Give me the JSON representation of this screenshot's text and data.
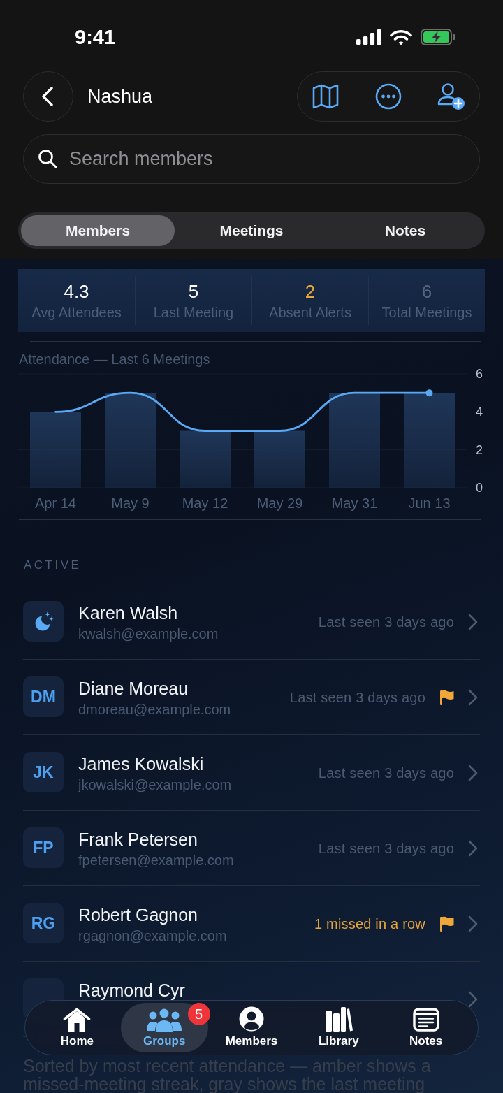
{
  "status_bar": {
    "time": "9:41"
  },
  "header": {
    "title": "Nashua"
  },
  "search": {
    "placeholder": "Search members"
  },
  "tabs": [
    {
      "label": "Members",
      "selected": true
    },
    {
      "label": "Meetings",
      "selected": false
    },
    {
      "label": "Notes",
      "selected": false
    }
  ],
  "stats": [
    {
      "value": "4.3",
      "label": "Avg Attendees",
      "color": "#ffffff"
    },
    {
      "value": "5",
      "label": "Last Meeting",
      "color": "#ffffff"
    },
    {
      "value": "2",
      "label": "Absent Alerts",
      "color": "#e8a53a"
    },
    {
      "value": "6",
      "label": "Total Meetings",
      "color": "#56667d"
    }
  ],
  "chart": {
    "chart_data": {
      "type": "bar",
      "title": "Attendance — Last 6 Meetings",
      "categories": [
        "Apr 14",
        "May 9",
        "May 12",
        "May 29",
        "May 31",
        "Jun 13"
      ],
      "series": [
        {
          "color": "#1f3658",
          "values": [
            4,
            5,
            3,
            3,
            5,
            5
          ]
        },
        {
          "type": "line",
          "color": "#5aa9f5",
          "values": [
            4,
            5,
            3,
            3,
            5,
            5
          ]
        }
      ],
      "ylim": [
        0,
        6
      ],
      "yticks": [
        {
          "value": 0,
          "label": "0"
        },
        {
          "value": 2,
          "label": "2"
        },
        {
          "value": 4,
          "label": "4"
        },
        {
          "value": 6,
          "label": "6"
        }
      ]
    }
  },
  "section": {
    "title": "ACTIVE",
    "members": [
      {
        "name": "Karen Walsh",
        "email": "kwalsh@example.com",
        "avatar": {
          "kind": "icon"
        },
        "status": {
          "text": "Last seen 3 days ago",
          "color": "#4b5a70"
        },
        "flagged": false
      },
      {
        "name": "Diane Moreau",
        "email": "dmoreau@example.com",
        "avatar": {
          "kind": "initials",
          "initials": "DM"
        },
        "status": {
          "text": "Last seen 3 days ago",
          "color": "#4b5a70"
        },
        "flagged": true
      },
      {
        "name": "James Kowalski",
        "email": "jkowalski@example.com",
        "avatar": {
          "kind": "initials",
          "initials": "JK"
        },
        "status": {
          "text": "Last seen 3 days ago",
          "color": "#4b5a70"
        },
        "flagged": false
      },
      {
        "name": "Frank Petersen",
        "email": "fpetersen@example.com",
        "avatar": {
          "kind": "initials",
          "initials": "FP"
        },
        "status": {
          "text": "Last seen 3 days ago",
          "color": "#4b5a70"
        },
        "flagged": false
      },
      {
        "name": "Robert Gagnon",
        "email": "rgagnon@example.com",
        "avatar": {
          "kind": "initials",
          "initials": "RG"
        },
        "status": {
          "text": "1 missed in a row",
          "color": "#e8a53a"
        },
        "flagged": true
      },
      {
        "name": "Raymond Cyr",
        "avatar": {
          "kind": "initials"
        },
        "flagged": false
      }
    ]
  },
  "footer_note": "Sorted by most recent attendance — amber shows a missed-meeting streak, gray shows the last meeting",
  "tab_bar": [
    {
      "label": "Home",
      "selected": false
    },
    {
      "label": "Groups",
      "selected": true,
      "badge": "5"
    },
    {
      "label": "Members",
      "selected": false
    },
    {
      "label": "Library",
      "selected": false
    },
    {
      "label": "Notes",
      "selected": false
    }
  ]
}
